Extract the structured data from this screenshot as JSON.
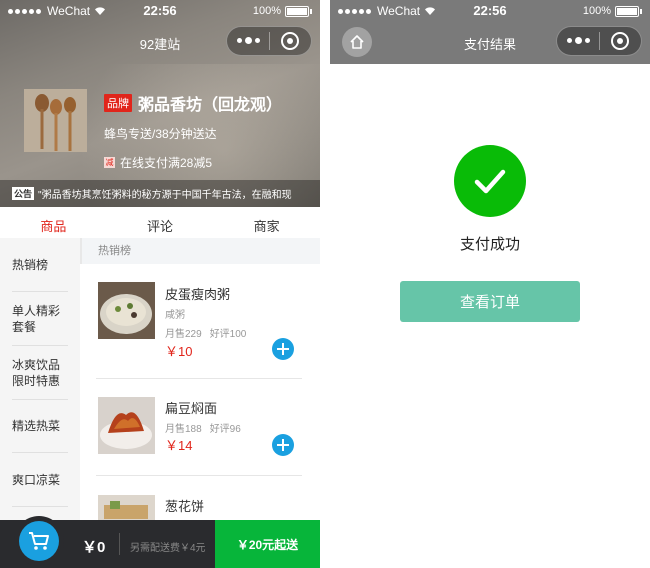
{
  "status_bar": {
    "carrier": "WeChat",
    "time": "22:56",
    "battery": "100%"
  },
  "left": {
    "nav_title": "92建站",
    "shop": {
      "brand_badge": "品牌",
      "name": "粥品香坊（回龙观）",
      "delivery": "蜂鸟专送/38分钟送达",
      "promo_icon": "减",
      "promo": "在线支付满28减5",
      "notice_tag": "公告",
      "notice": "\"粥品香坊其烹饪粥料的秘方源于中国千年古法，在融和现"
    },
    "tabs": [
      "商品",
      "评论",
      "商家"
    ],
    "categories": [
      "热销榜",
      "单人精彩套餐",
      "冰爽饮品限时特惠",
      "精选热菜",
      "爽口凉菜"
    ],
    "list_header": "热销榜",
    "items": [
      {
        "name": "皮蛋瘦肉粥",
        "desc": "咸粥",
        "sales": "月售229",
        "rating": "好评100",
        "price": "￥10"
      },
      {
        "name": "扁豆焖面",
        "desc": "",
        "sales": "月售188",
        "rating": "好评96",
        "price": "￥14"
      },
      {
        "name": "葱花饼",
        "desc": "",
        "sales": "",
        "rating": "",
        "price": ""
      }
    ],
    "cart": {
      "total": "￥0",
      "fee": "另需配送费￥4元",
      "checkout": "￥20元起送"
    }
  },
  "right": {
    "nav_title": "支付结果",
    "success_text": "支付成功",
    "view_order": "查看订单"
  },
  "colors": {
    "accent_red": "#e1251b",
    "add_blue": "#1aa0e0",
    "checkout_green": "#07b53a",
    "success_green": "#09bb07",
    "button_teal": "#66c5a8"
  },
  "icons": {
    "home": "home-icon",
    "check": "checkmark-icon",
    "cart": "cart-icon",
    "add": "plus-icon",
    "more": "more-dots-icon",
    "close": "mini-program-close-icon"
  }
}
